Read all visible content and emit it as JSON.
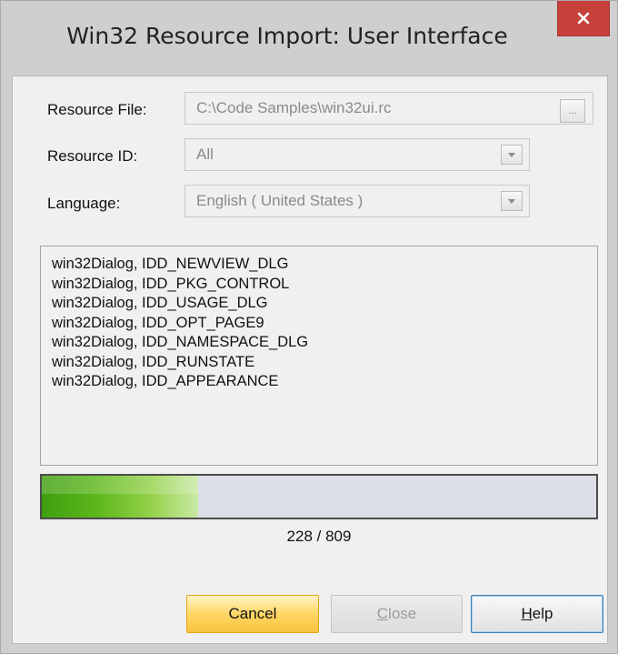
{
  "window": {
    "title": "Win32 Resource Import: User Interface",
    "close_glyph": "close-icon"
  },
  "form": {
    "resource_file": {
      "label": "Resource File:",
      "value": "C:\\Code Samples\\win32ui.rc",
      "browse_label": "..."
    },
    "resource_id": {
      "label": "Resource ID:",
      "value": "All"
    },
    "language": {
      "label": "Language:",
      "value": "English ( United States )"
    }
  },
  "resource_list": [
    "win32Dialog, IDD_NEWVIEW_DLG",
    "win32Dialog, IDD_PKG_CONTROL",
    "win32Dialog, IDD_USAGE_DLG",
    "win32Dialog, IDD_OPT_PAGE9",
    "win32Dialog, IDD_NAMESPACE_DLG",
    "win32Dialog, IDD_RUNSTATE",
    "win32Dialog, IDD_APPEARANCE"
  ],
  "progress": {
    "current": 228,
    "total": 809,
    "text": "228 / 809"
  },
  "buttons": {
    "cancel": "Cancel",
    "close_mnemonic": "C",
    "close_rest": "lose",
    "help_mnemonic": "H",
    "help_rest": "elp"
  },
  "colors": {
    "close_button": "#c7403a",
    "progress_green": "#5cb71b",
    "default_button": "#ffd765"
  }
}
